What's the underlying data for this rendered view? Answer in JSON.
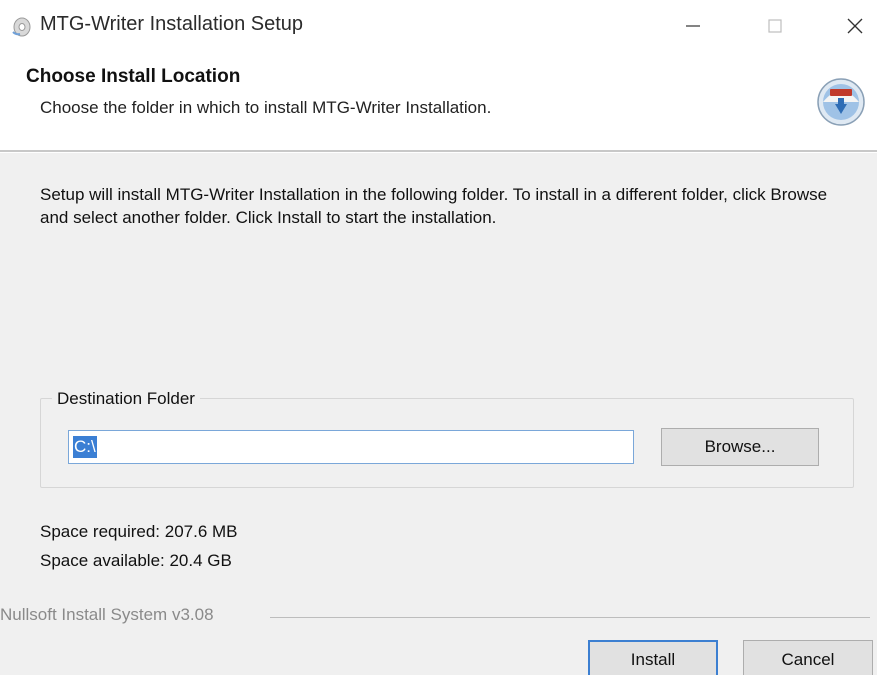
{
  "window": {
    "title": "MTG-Writer Installation Setup",
    "icon": "installer-disc-icon"
  },
  "title_controls": {
    "minimize": "—",
    "maximize": "☐",
    "close": "✕"
  },
  "header": {
    "title": "Choose Install Location",
    "subtitle": "Choose the folder in which to install MTG-Writer Installation.",
    "icon": "nsis-installer-icon"
  },
  "body": {
    "description": "Setup will install MTG-Writer Installation in the following folder. To install in a different folder, click Browse and select another folder. Click Install to start the installation."
  },
  "destination": {
    "group_label": "Destination Folder",
    "path_value": "C:\\",
    "browse_label": "Browse..."
  },
  "space": {
    "required": "Space required: 207.6 MB",
    "available": "Space available: 20.4 GB"
  },
  "footer": {
    "branding": "Nullsoft Install System v3.08",
    "install_label": "Install",
    "cancel_label": "Cancel"
  },
  "colors": {
    "accent": "#3c7fd1",
    "selection": "#3b7fd4",
    "window_bg": "#f0f0f0"
  }
}
